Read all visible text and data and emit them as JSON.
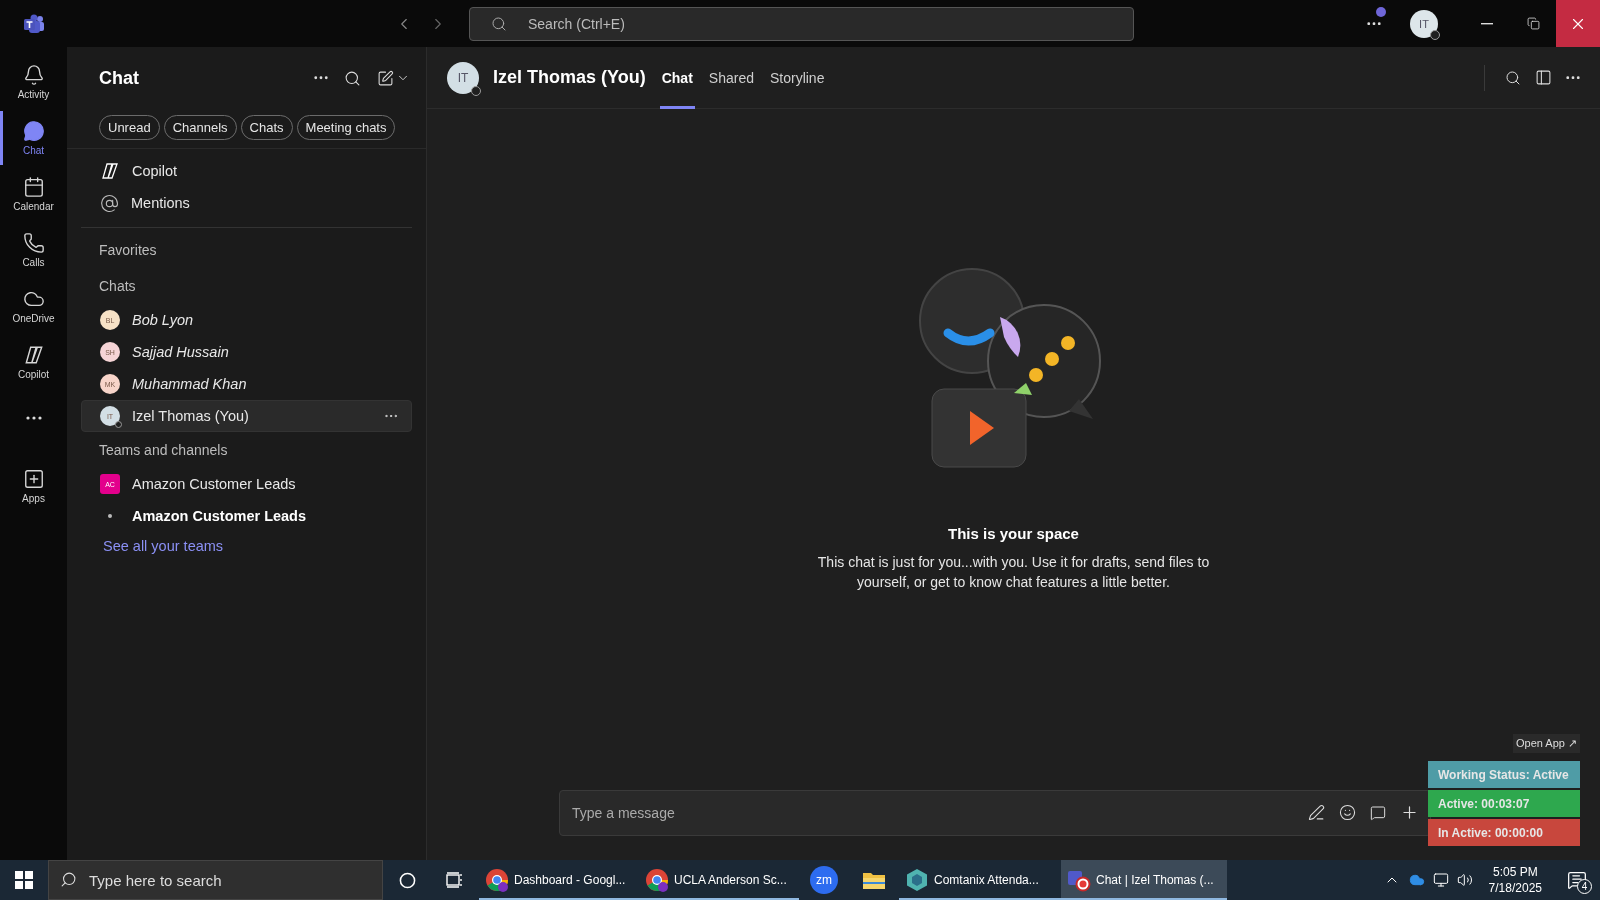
{
  "titlebar": {
    "search_placeholder": "Search (Ctrl+E)",
    "avatar": "IT",
    "notification_dot": true
  },
  "rail": [
    {
      "kind": "bell",
      "label": "Activity",
      "selected": false
    },
    {
      "kind": "chat",
      "label": "Chat",
      "selected": true
    },
    {
      "kind": "calendar",
      "label": "Calendar",
      "selected": false
    },
    {
      "kind": "phone",
      "label": "Calls",
      "selected": false
    },
    {
      "kind": "cloud",
      "label": "OneDrive",
      "selected": false
    },
    {
      "kind": "copilot",
      "label": "Copilot",
      "selected": false
    },
    {
      "kind": "more"
    },
    {
      "kind": "apps",
      "label": "Apps",
      "selected": false
    }
  ],
  "chat_panel": {
    "title": "Chat",
    "filters": [
      {
        "label": "Unread"
      },
      {
        "label": "Channels"
      },
      {
        "label": "Chats"
      },
      {
        "label": "Meeting chats"
      }
    ],
    "quick_links": [
      {
        "kind": "copilot",
        "label": "Copilot"
      },
      {
        "kind": "mention",
        "label": "Mentions"
      }
    ],
    "sections": [
      {
        "heading": "Favorites"
      },
      {
        "heading": "Chats",
        "items": [
          {
            "kind": "chat",
            "initials": "BL",
            "name": "Bob Lyon",
            "color": "#f7e2c6",
            "italic": true,
            "selected": false
          },
          {
            "kind": "chat",
            "initials": "SH",
            "name": "Sajjad Hussain",
            "color": "#f6d4d6",
            "italic": true,
            "selected": false
          },
          {
            "kind": "chat",
            "initials": "MK",
            "name": "Muhammad Khan",
            "color": "#f7d4c9",
            "italic": true,
            "selected": false
          },
          {
            "kind": "chat",
            "initials": "IT",
            "name": "Izel Thomas (You)",
            "color": "#d3dfe5",
            "italic": false,
            "selected": true
          }
        ]
      },
      {
        "heading": "Teams and channels",
        "items": [
          {
            "kind": "team",
            "initials": "AC",
            "name": "Amazon Customer Leads",
            "color": "#e3008c"
          },
          {
            "kind": "channel",
            "name": "Amazon Customer Leads",
            "unread": true
          },
          {
            "kind": "link",
            "name": "See all your teams"
          }
        ]
      }
    ]
  },
  "conversation": {
    "avatar": "IT",
    "name": "Izel Thomas (You)",
    "tabs": [
      {
        "label": "Chat",
        "selected": true
      },
      {
        "label": "Shared",
        "selected": false
      },
      {
        "label": "Storyline",
        "selected": false
      }
    ],
    "empty_title": "This is your space",
    "empty_text": "This chat is just for you...with you. Use it for drafts, send files to yourself, or get to know chat features a little better.",
    "composer_placeholder": "Type a message"
  },
  "tracker": {
    "open_label": "Open App ↗",
    "rows": [
      {
        "label": "Working Status: Active",
        "color": "#4f9ca6"
      },
      {
        "label": "Active: 00:03:07",
        "color": "#2ea84e"
      },
      {
        "label": "In Active: 00:00:00",
        "color": "#c8473d"
      }
    ]
  },
  "taskbar": {
    "search_placeholder": "Type here to search",
    "apps": [
      {
        "kind": "chrome",
        "label": "Dashboard - Googl...",
        "selected": false,
        "open": true
      },
      {
        "kind": "chrome",
        "label": "UCLA Anderson Sc...",
        "selected": false,
        "open": true
      },
      {
        "kind": "zoom",
        "label": "zm",
        "selected": false,
        "open": false
      },
      {
        "kind": "folder",
        "selected": false,
        "open": false
      },
      {
        "kind": "comtanix",
        "label": "Comtanix Attenda...",
        "selected": false,
        "open": true
      },
      {
        "kind": "teams",
        "label": "Chat | Izel Thomas (...",
        "selected": true,
        "open": true
      }
    ],
    "time": "5:05 PM",
    "date": "7/18/2025",
    "notifications": "4"
  }
}
